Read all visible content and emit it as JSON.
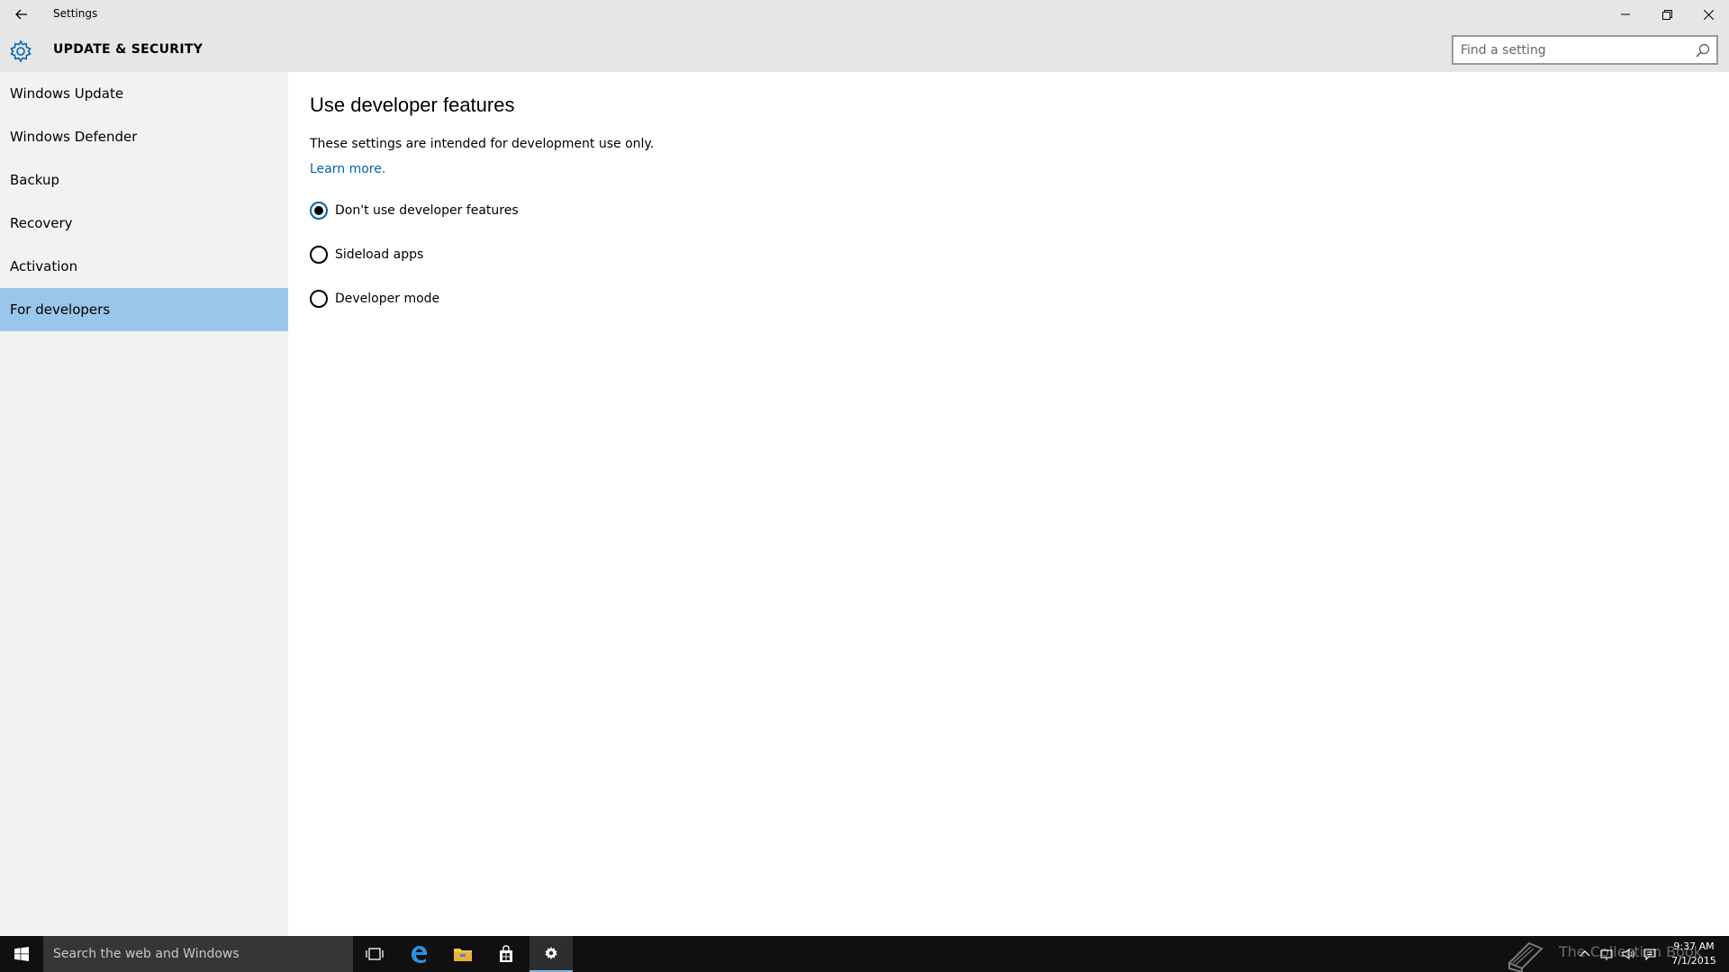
{
  "window": {
    "app_title": "Settings",
    "section_title": "UPDATE & SECURITY",
    "search_placeholder": "Find a setting",
    "search_value": ""
  },
  "sidebar": {
    "items": [
      {
        "label": "Windows Update"
      },
      {
        "label": "Windows Defender"
      },
      {
        "label": "Backup"
      },
      {
        "label": "Recovery"
      },
      {
        "label": "Activation"
      },
      {
        "label": "For developers"
      }
    ],
    "active_item": "For developers"
  },
  "main": {
    "title": "Use developer features",
    "description": "These settings are intended for development use only.",
    "learn_more": "Learn more.",
    "options": [
      {
        "label": "Don't use developer features",
        "checked": true
      },
      {
        "label": "Sideload apps",
        "checked": false
      },
      {
        "label": "Developer mode",
        "checked": false
      }
    ]
  },
  "taskbar": {
    "search_placeholder": "Search the web and Windows",
    "watermark": "The Collection Book",
    "time": "9:37 AM",
    "date": "7/1/2015"
  },
  "colors": {
    "accent": "#0063b1",
    "active_nav": "#99c6ea",
    "titlebar": "#e6e6e6",
    "sidebar": "#f2f2f2",
    "taskbar": "#101010"
  },
  "icons": {
    "back": "back-arrow-icon",
    "section": "gear-icon",
    "search": "search-icon",
    "minimize": "minimize-icon",
    "maximize": "restore-icon",
    "close": "close-icon"
  }
}
